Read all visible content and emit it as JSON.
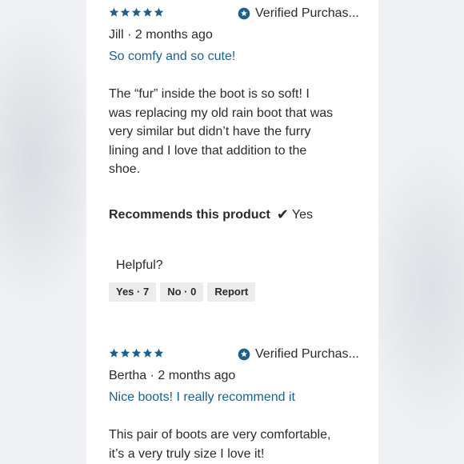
{
  "reviews": [
    {
      "rating": 5,
      "verified_label": "Verified Purchas...",
      "author_line": "Jill · 2 months ago",
      "headline": "So comfy and so cute!",
      "body_lines": [
        "The “fur” inside the boot is so soft! I",
        "was replacing my old rain boot that was",
        "very similar but didn’t have the furry",
        "lining and I love that addition to the",
        "shoe."
      ],
      "recommends_label": "Recommends this product",
      "recommends_value": "Yes",
      "helpful_label": "Helpful?",
      "yes_button": "Yes · 7",
      "no_button": "No · 0",
      "report_button": "Report"
    },
    {
      "rating": 5,
      "verified_label": "Verified Purchas...",
      "author_line": "Bertha · 2 months ago",
      "headline": "Nice boots! I really recommend it",
      "body_lines": [
        "This pair of boots are very comfortable,",
        "it’s a very truly size I love it!"
      ]
    }
  ],
  "colors": {
    "star": "#1f5f8b",
    "headline": "#1f5f8b",
    "badge": "#1f5f8b",
    "button_bg": "#ececec"
  },
  "icons": {
    "star": "star-icon",
    "verified": "verified-badge-icon",
    "check": "checkmark-icon"
  }
}
